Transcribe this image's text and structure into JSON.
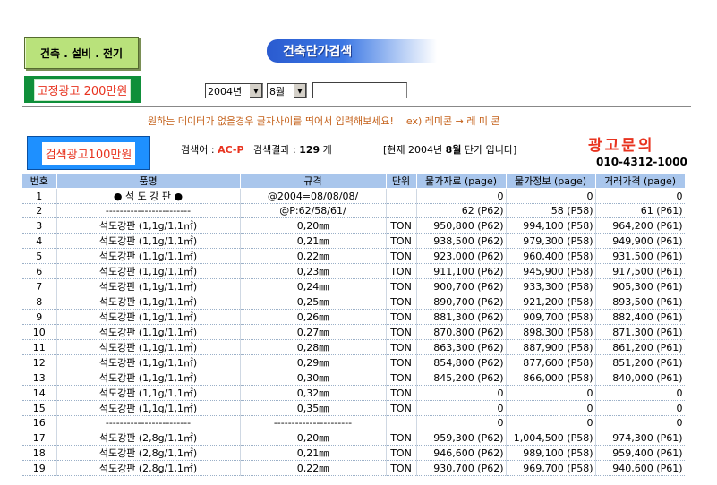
{
  "category_button": "건축 . 설비 . 전기",
  "ad_button_200": "고정광고 200만원",
  "title": "건축단가검색",
  "year_select": "2004년",
  "month_select": "8월",
  "search_value": "",
  "hint": "원하는 데이터가 없을경우 글자사이를 띄어서 입력해보세요!    ex) 레미콘 → 레 미 콘",
  "ad_button_100": "검색광고100만원",
  "search_label": "검색어 : ",
  "keyword": "AC-P",
  "result_label": "검색결과 : ",
  "result_count": "129",
  "result_unit": " 개",
  "current_prefix": "[현재 2004년 ",
  "current_month": "8월",
  "current_suffix": " 단가 입니다]",
  "ad_inquiry": "광고문의",
  "phone": "010-4312-1000",
  "columns": [
    "번호",
    "품명",
    "규격",
    "단위",
    "물가자료 (page)",
    "물가정보 (page)",
    "거래가격 (page)"
  ],
  "rows": [
    [
      "1",
      "● 석 도 강 판 ●",
      "@2004=08/08/08/",
      "",
      "0",
      "0",
      "0"
    ],
    [
      "2",
      "------------------------",
      "@P:62/58/61/",
      "",
      "62 (P62)",
      "58 (P58)",
      "61 (P61)"
    ],
    [
      "3",
      "석도강판 (1,1g/1,1㎡)",
      "0,20㎜",
      "TON",
      "950,800 (P62)",
      "994,100 (P58)",
      "964,200 (P61)"
    ],
    [
      "4",
      "석도강판 (1,1g/1,1㎡)",
      "0,21㎜",
      "TON",
      "938,500 (P62)",
      "979,300 (P58)",
      "949,900 (P61)"
    ],
    [
      "5",
      "석도강판 (1,1g/1,1㎡)",
      "0,22㎜",
      "TON",
      "923,000 (P62)",
      "960,400 (P58)",
      "931,500 (P61)"
    ],
    [
      "6",
      "석도강판 (1,1g/1,1㎡)",
      "0,23㎜",
      "TON",
      "911,100 (P62)",
      "945,900 (P58)",
      "917,500 (P61)"
    ],
    [
      "7",
      "석도강판 (1,1g/1,1㎡)",
      "0,24㎜",
      "TON",
      "900,700 (P62)",
      "933,300 (P58)",
      "905,300 (P61)"
    ],
    [
      "8",
      "석도강판 (1,1g/1,1㎡)",
      "0,25㎜",
      "TON",
      "890,700 (P62)",
      "921,200 (P58)",
      "893,500 (P61)"
    ],
    [
      "9",
      "석도강판 (1,1g/1,1㎡)",
      "0,26㎜",
      "TON",
      "881,300 (P62)",
      "909,700 (P58)",
      "882,400 (P61)"
    ],
    [
      "10",
      "석도강판 (1,1g/1,1㎡)",
      "0,27㎜",
      "TON",
      "870,800 (P62)",
      "898,300 (P58)",
      "871,300 (P61)"
    ],
    [
      "11",
      "석도강판 (1,1g/1,1㎡)",
      "0,28㎜",
      "TON",
      "863,300 (P62)",
      "887,900 (P58)",
      "861,200 (P61)"
    ],
    [
      "12",
      "석도강판 (1,1g/1,1㎡)",
      "0,29㎜",
      "TON",
      "854,800 (P62)",
      "877,600 (P58)",
      "851,200 (P61)"
    ],
    [
      "13",
      "석도강판 (1,1g/1,1㎡)",
      "0,30㎜",
      "TON",
      "845,200 (P62)",
      "866,000 (P58)",
      "840,000 (P61)"
    ],
    [
      "14",
      "석도강판 (1,1g/1,1㎡)",
      "0,32㎜",
      "TON",
      "0",
      "0",
      "0"
    ],
    [
      "15",
      "석도강판 (1,1g/1,1㎡)",
      "0,35㎜",
      "TON",
      "0",
      "0",
      "0"
    ],
    [
      "16",
      "------------------------",
      "----------------------",
      "",
      "0",
      "0",
      "0"
    ],
    [
      "17",
      "석도강판 (2,8g/1,1㎡)",
      "0,20㎜",
      "TON",
      "959,300 (P62)",
      "1,004,500 (P58)",
      "974,300 (P61)"
    ],
    [
      "18",
      "석도강판 (2,8g/1,1㎡)",
      "0,21㎜",
      "TON",
      "946,600 (P62)",
      "989,100 (P58)",
      "959,400 (P61)"
    ],
    [
      "19",
      "석도강판 (2,8g/1,1㎡)",
      "0,22㎜",
      "TON",
      "930,700 (P62)",
      "969,700 (P58)",
      "940,600 (P61)"
    ]
  ]
}
